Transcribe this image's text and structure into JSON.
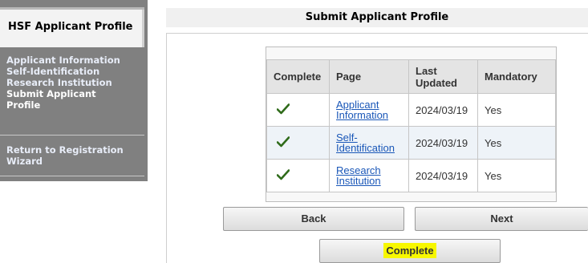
{
  "sidebar": {
    "header": "HSF Applicant Profile",
    "items": [
      {
        "label": "Applicant Information"
      },
      {
        "label": "Self-Identification"
      },
      {
        "label": "Research Institution"
      },
      {
        "label": "Submit Applicant Profile"
      }
    ],
    "return_label": "Return to Registration Wizard"
  },
  "main": {
    "title": "Submit Applicant Profile",
    "table": {
      "columns": [
        "Complete",
        "Page",
        "Last Updated",
        "Mandatory"
      ],
      "rows": [
        {
          "complete": "check-icon",
          "page": "Applicant Information",
          "updated": "2024/03/19",
          "mandatory": "Yes"
        },
        {
          "complete": "check-icon",
          "page": "Self-Identification",
          "updated": "2024/03/19",
          "mandatory": "Yes"
        },
        {
          "complete": "check-icon",
          "page": "Research Institution",
          "updated": "2024/03/19",
          "mandatory": "Yes"
        }
      ]
    },
    "buttons": {
      "back": "Back",
      "next": "Next",
      "complete": "Complete"
    }
  },
  "colors": {
    "sidebar_bg": "#808080",
    "link": "#1a57b8",
    "check": "#2f6b1a",
    "highlight": "#f7f700"
  }
}
